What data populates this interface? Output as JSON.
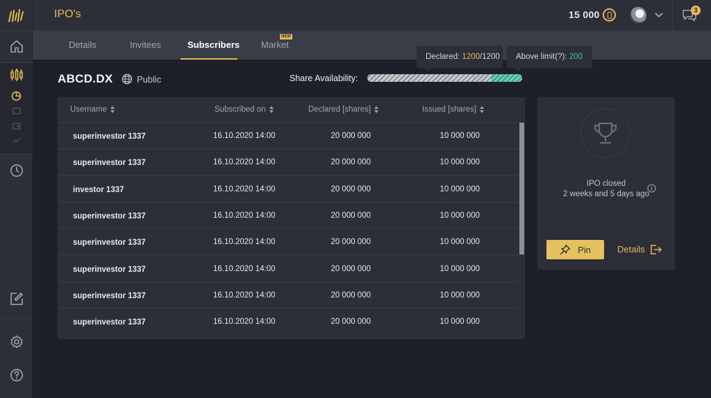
{
  "app": {
    "page_title": "IPO's",
    "balance": "15 000",
    "notifications_count": "3",
    "accent_color": "#e6b955",
    "icons": {
      "logo": "brand-logo-icon",
      "coin": "coin-icon",
      "chat": "chat-icon",
      "caret": "chevron-down-icon"
    }
  },
  "sidebar": {
    "items": [
      {
        "name": "home",
        "icon": "home-icon"
      },
      {
        "name": "trading",
        "icon": "candles-icon",
        "active": true
      },
      {
        "name": "ipo",
        "icon": "pie-chart-icon",
        "active": true
      },
      {
        "name": "sub-1",
        "icon": "card-icon"
      },
      {
        "name": "sub-2",
        "icon": "wallet-icon"
      },
      {
        "name": "sub-3",
        "icon": "trend-icon"
      },
      {
        "name": "history",
        "icon": "clock-icon"
      },
      {
        "name": "edit",
        "icon": "edit-icon"
      },
      {
        "name": "settings",
        "icon": "gear-icon"
      },
      {
        "name": "help",
        "icon": "help-icon"
      }
    ]
  },
  "tabs": [
    {
      "label": "Details"
    },
    {
      "label": "Invitees"
    },
    {
      "label": "Subscribers",
      "active": true
    },
    {
      "label": "Market",
      "badge": "NEW"
    }
  ],
  "asset": {
    "name": "ABCD.DX",
    "visibility": "Public"
  },
  "availability": {
    "label": "Share Availability:",
    "declared_label": "Declared:",
    "declared_value": "1200",
    "declared_total": "/1200",
    "above_label": "Above limit(?):",
    "above_value": "200",
    "declared_fraction": 0.8,
    "above_fraction": 0.2,
    "declared_color": "#8c8e94",
    "above_color": "#4fc4a4"
  },
  "table": {
    "columns": [
      "Username",
      "Subscribed on",
      "Declared [shares]",
      "Issued [shares]"
    ],
    "rows": [
      {
        "user": "superinvestor 1337",
        "date": "16.10.2020  14:00",
        "declared": "20 000 000",
        "issued": "10 000 000"
      },
      {
        "user": "superinvestor 1337",
        "date": "16.10.2020  14:00",
        "declared": "20 000 000",
        "issued": "10 000 000"
      },
      {
        "user": "investor 1337",
        "date": "16.10.2020  14:00",
        "declared": "20 000 000",
        "issued": "10 000 000"
      },
      {
        "user": "superinvestor 1337",
        "date": "16.10.2020  14:00",
        "declared": "20 000 000",
        "issued": "10 000 000"
      },
      {
        "user": "superinvestor 1337",
        "date": "16.10.2020  14:00",
        "declared": "20 000 000",
        "issued": "10 000 000"
      },
      {
        "user": "superinvestor 1337",
        "date": "16.10.2020  14:00",
        "declared": "20 000 000",
        "issued": "10 000 000"
      },
      {
        "user": "superinvestor 1337",
        "date": "16.10.2020  14:00",
        "declared": "20 000 000",
        "issued": "10 000 000"
      },
      {
        "user": "superinvestor 1337",
        "date": "16.10.2020  14:00",
        "declared": "20 000 000",
        "issued": "10 000 000"
      }
    ]
  },
  "status_card": {
    "icon": "trophy-icon",
    "title": "IPO closed",
    "subtitle": "2 weeks and 5 days ago",
    "pin_label": "Pin",
    "details_label": "Details"
  }
}
